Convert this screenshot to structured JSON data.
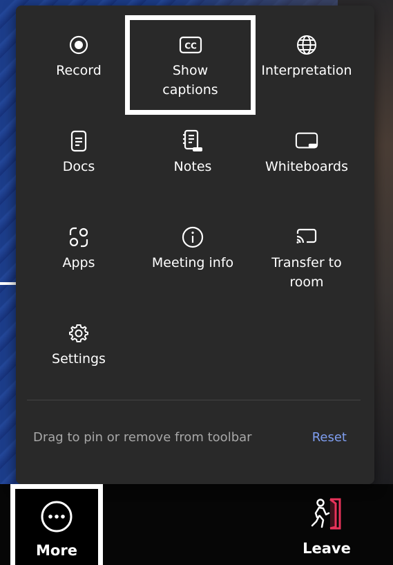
{
  "menu": {
    "items": [
      {
        "label": "Record",
        "icon": "record-icon"
      },
      {
        "label": "Show\ncaptions",
        "icon": "closed-captions-icon"
      },
      {
        "label": "Interpretation",
        "icon": "globe-icon"
      },
      {
        "label": "Docs",
        "icon": "document-icon"
      },
      {
        "label": "Notes",
        "icon": "notebook-icon"
      },
      {
        "label": "Whiteboards",
        "icon": "whiteboard-icon"
      },
      {
        "label": "Apps",
        "icon": "apps-icon"
      },
      {
        "label": "Meeting info",
        "icon": "info-icon"
      },
      {
        "label": "Transfer to\nroom",
        "icon": "cast-icon"
      },
      {
        "label": "Settings",
        "icon": "gear-icon"
      }
    ],
    "footer_hint": "Drag to pin or remove from toolbar",
    "reset_label": "Reset"
  },
  "toolbar": {
    "more_label": "More",
    "leave_label": "Leave"
  },
  "colors": {
    "panel_bg": "#292929",
    "link_accent": "#7f9ef0",
    "leave_accent": "#e8335a"
  }
}
